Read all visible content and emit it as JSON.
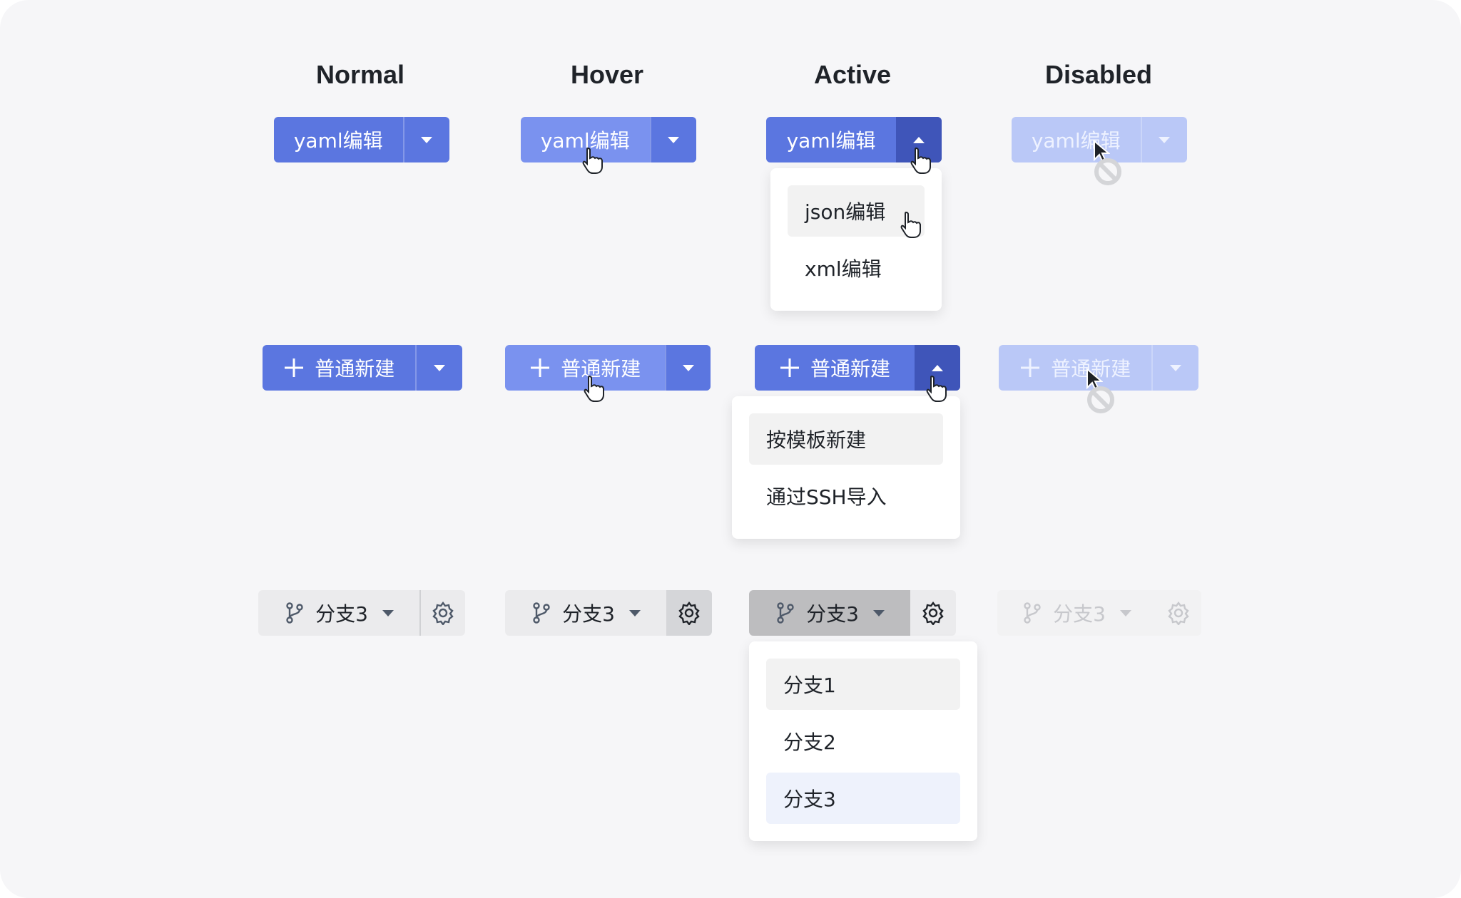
{
  "columns": [
    "Normal",
    "Hover",
    "Active",
    "Disabled"
  ],
  "yaml_row": {
    "label": "yaml编辑",
    "menu": [
      "json编辑",
      "xml编辑"
    ]
  },
  "new_row": {
    "label": "普通新建",
    "menu": [
      "按模板新建",
      "通过SSH导入"
    ]
  },
  "branch_row": {
    "label": "分支3",
    "menu": [
      "分支1",
      "分支2",
      "分支3"
    ],
    "selected": "分支3"
  },
  "colors": {
    "primary": "#5b76e0",
    "primary_hover": "#7a92ef",
    "primary_active": "#3f55b9",
    "primary_disabled": "#bac8f7",
    "gray_button": "#ebebed",
    "gray_hover": "#d5d6d9",
    "gray_active": "#bdbdbf",
    "selected_item": "#eef2fc",
    "hover_item": "#f2f2f2"
  },
  "icons": [
    "caret-down-icon",
    "caret-up-icon",
    "plus-icon",
    "branch-icon",
    "gear-icon",
    "hand-pointer-icon",
    "arrow-cursor-icon",
    "not-allowed-icon"
  ]
}
